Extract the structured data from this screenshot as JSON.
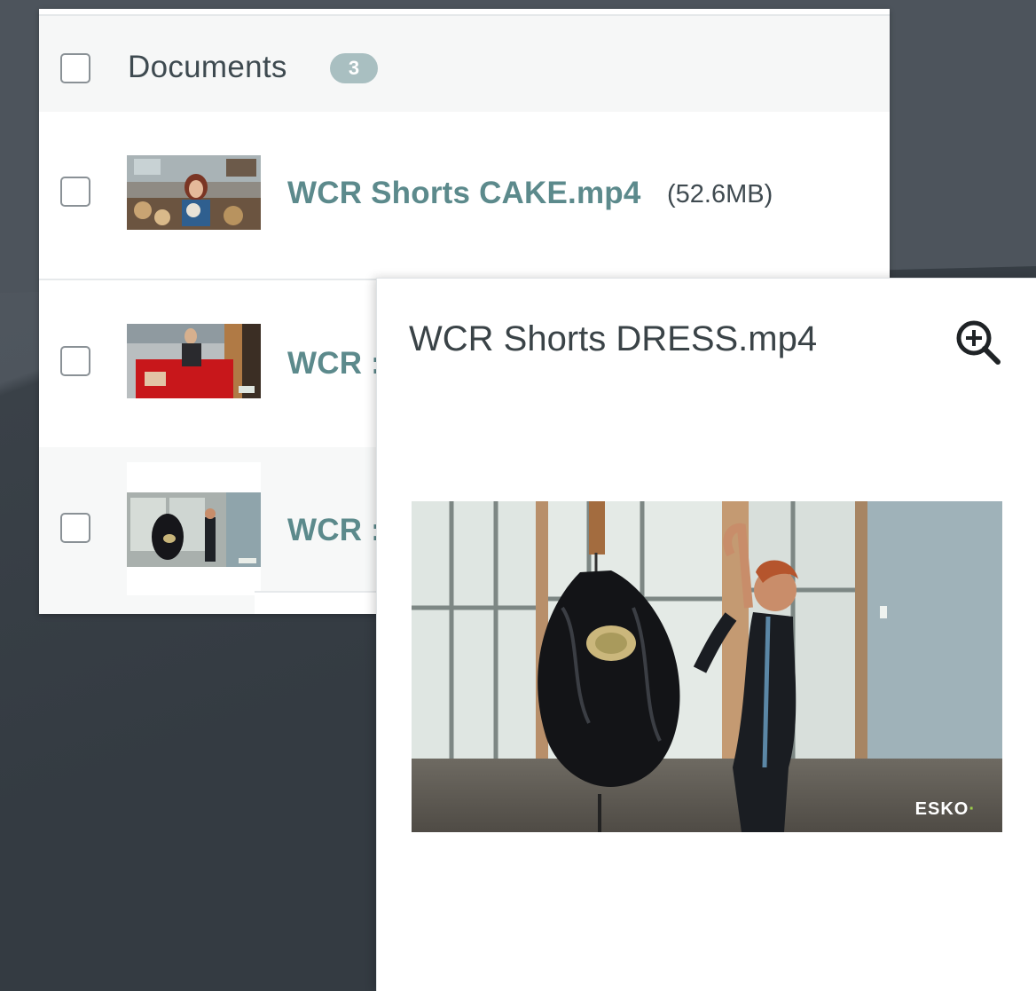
{
  "header": {
    "title": "Documents",
    "count": "3"
  },
  "documents": [
    {
      "name": "WCR Shorts CAKE.mp4",
      "size": "(52.6MB)"
    },
    {
      "name": "WCR :"
    },
    {
      "name": "WCR :"
    }
  ],
  "preview": {
    "title": "WCR Shorts DRESS.mp4",
    "zoom_icon": "zoom-in-icon",
    "watermark": "ESKO"
  },
  "colors": {
    "link": "#5c8a8c",
    "badge": "#a9bfc1",
    "background": "#343b42"
  }
}
